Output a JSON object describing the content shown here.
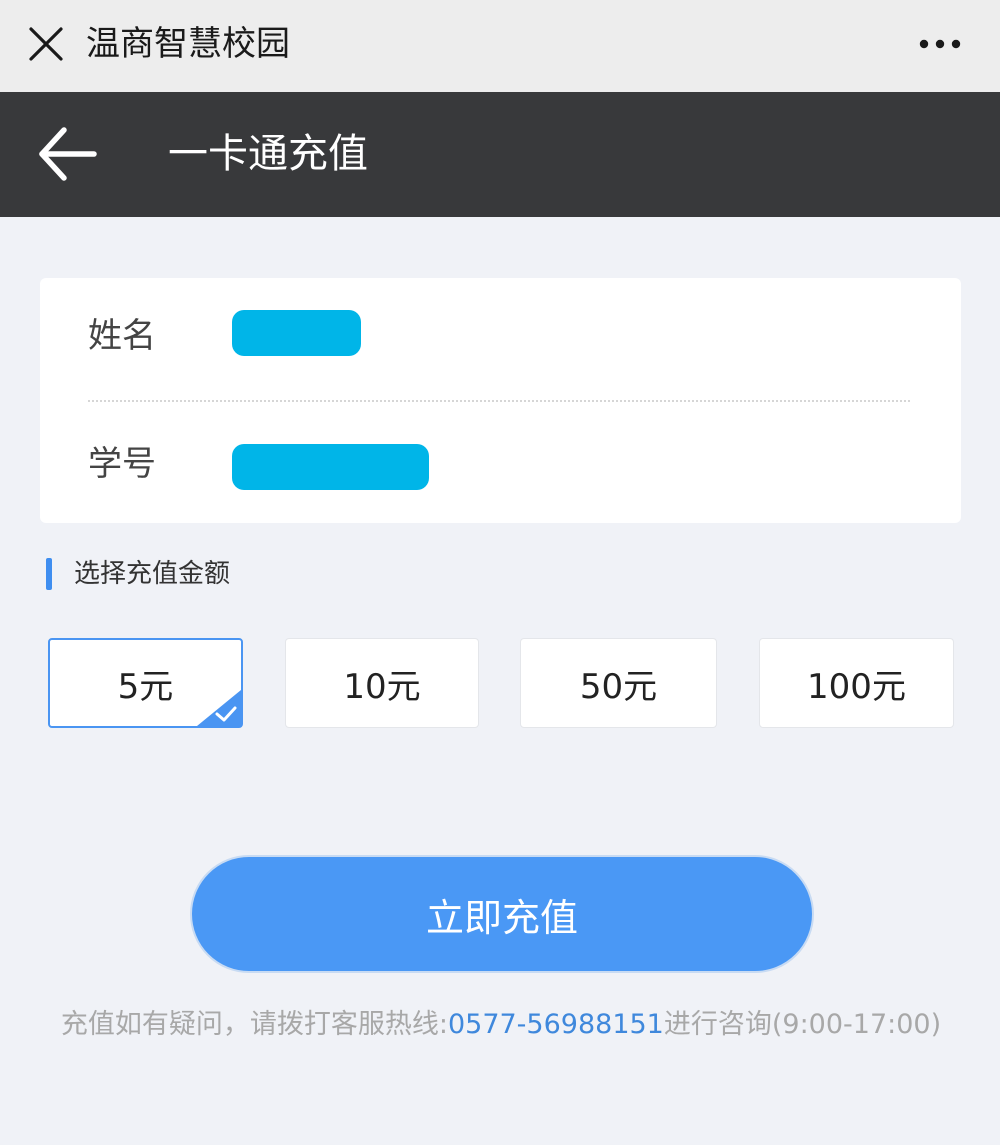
{
  "window": {
    "title": "温商智慧校园"
  },
  "navbar": {
    "title": "一卡通充值"
  },
  "card": {
    "name_label": "姓名",
    "id_label": "学号"
  },
  "section": {
    "title": "选择充值金额"
  },
  "amounts": [
    {
      "label": "5元",
      "selected": true
    },
    {
      "label": "10元",
      "selected": false
    },
    {
      "label": "50元",
      "selected": false
    },
    {
      "label": "100元",
      "selected": false
    }
  ],
  "cta": {
    "label": "立即充值"
  },
  "footnote": {
    "prefix": "充值如有疑问，请拨打客服热线:",
    "phone": "0577-56988151",
    "suffix": "进行咨询(9:00-17:00)"
  },
  "colors": {
    "accent": "#4a98f5",
    "navbar": "#38393b",
    "redaction": "#00b5e8",
    "phone_link": "#3f88dc"
  },
  "icons": [
    "close-icon",
    "more-icon",
    "back-arrow-icon",
    "check-icon"
  ]
}
